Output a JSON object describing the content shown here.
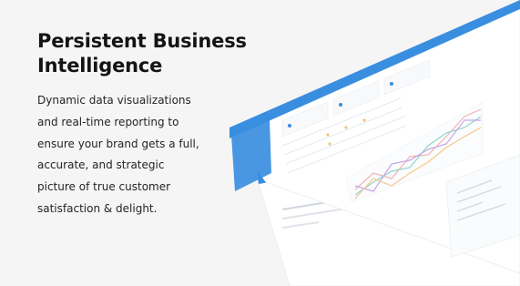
{
  "hero": {
    "title_lines": [
      "Persistent Business",
      "Intelligence"
    ],
    "body_lines": [
      "Dynamic data visualizations",
      "and real-time reporting to",
      "ensure your brand gets a full,",
      "accurate, and strategic",
      "picture of true customer",
      "satisfaction & delight."
    ]
  },
  "mockup": {
    "accent_color": "#3a8ee0",
    "panel_color": "#ffffff",
    "line_series_colors": [
      "#f2b3b3",
      "#8fd6c8",
      "#c9a3e6",
      "#f7c78a"
    ]
  }
}
